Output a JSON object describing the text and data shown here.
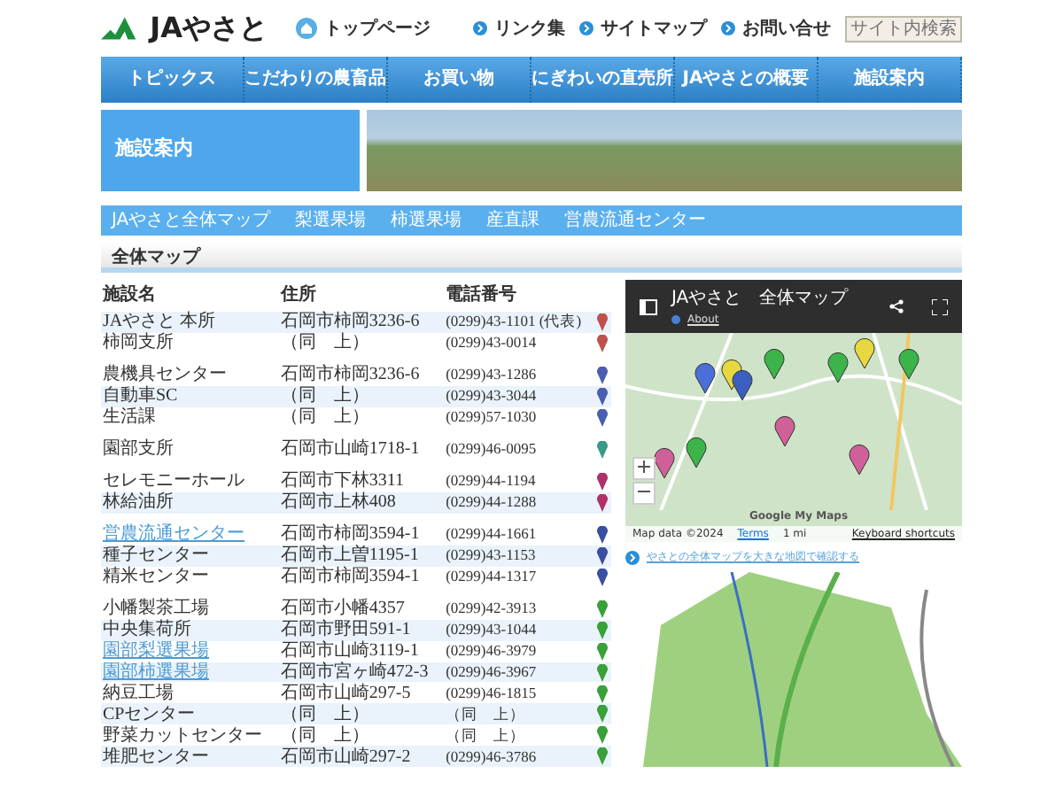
{
  "header": {
    "logo_text": "JAやさと",
    "home_link": "トップページ",
    "links": [
      "リンク集",
      "サイトマップ",
      "お問い合せ"
    ],
    "search": {
      "placeholder": "サイト内検索"
    }
  },
  "nav": [
    "トピックス",
    "こだわりの農畜品",
    "お買い物",
    "にぎわいの直売所",
    "JAやさとの概要",
    "施設案内"
  ],
  "hero": {
    "title": "施設案内"
  },
  "subnav": [
    "JAやさと全体マップ",
    "梨選果場",
    "柿選果場",
    "産直課",
    "営農流通センター"
  ],
  "section_title": "全体マップ",
  "table": {
    "columns": [
      "施設名",
      "住所",
      "電話番号"
    ],
    "groups": [
      {
        "rows": [
          {
            "name": "JAやさと 本所",
            "address": "石岡市柿岡3236-6",
            "phone": "(0299)43-1101 (代表)",
            "color": "#c0504d",
            "link": false
          },
          {
            "name": "柿岡支所",
            "address": "（同　上）",
            "phone": "(0299)43-0014",
            "color": "#c0504d",
            "link": false
          }
        ]
      },
      {
        "rows": [
          {
            "name": "農機具センター",
            "address": "石岡市柿岡3236-6",
            "phone": "(0299)43-1286",
            "color": "#4a5fb0",
            "link": false
          },
          {
            "name": "自動車SC",
            "address": "（同　上）",
            "phone": "(0299)43-3044",
            "color": "#4a5fb0",
            "link": false
          },
          {
            "name": "生活課",
            "address": "（同　上）",
            "phone": "(0299)57-1030",
            "color": "#4a5fb0",
            "link": false
          }
        ]
      },
      {
        "rows": [
          {
            "name": "園部支所",
            "address": "石岡市山崎1718-1",
            "phone": "(0299)46-0095",
            "color": "#3a9a8a",
            "link": false
          }
        ]
      },
      {
        "rows": [
          {
            "name": "セレモニーホール",
            "address": "石岡市下林3311",
            "phone": "(0299)44-1194",
            "color": "#b0306a",
            "link": false
          },
          {
            "name": "林給油所",
            "address": "石岡市上林408",
            "phone": "(0299)44-1288",
            "color": "#b0306a",
            "link": false
          }
        ]
      },
      {
        "rows": [
          {
            "name": "営農流通センター",
            "address": "石岡市柿岡3594-1",
            "phone": "(0299)44-1661",
            "color": "#3a4fa0",
            "link": true
          },
          {
            "name": "種子センター",
            "address": "石岡市上曽1195-1",
            "phone": "(0299)43-1153",
            "color": "#3a4fa0",
            "link": false
          },
          {
            "name": "精米センター",
            "address": "石岡市柿岡3594-1",
            "phone": "(0299)44-1317",
            "color": "#3a4fa0",
            "link": false
          }
        ]
      },
      {
        "rows": [
          {
            "name": "小幡製茶工場",
            "address": "石岡市小幡4357",
            "phone": "(0299)42-3913",
            "color": "#3aa03a",
            "link": false
          },
          {
            "name": "中央集荷所",
            "address": "石岡市野田591-1",
            "phone": "(0299)43-1044",
            "color": "#3aa03a",
            "link": false
          },
          {
            "name": "園部梨選果場",
            "address": "石岡市山崎3119-1",
            "phone": "(0299)46-3979",
            "color": "#3aa03a",
            "link": true
          },
          {
            "name": "園部柿選果場",
            "address": "石岡市宮ヶ崎472-3",
            "phone": "(0299)46-3967",
            "color": "#3aa03a",
            "link": true
          },
          {
            "name": "納豆工場",
            "address": "石岡市山崎297-5",
            "phone": "(0299)46-1815",
            "color": "#3aa03a",
            "link": false
          },
          {
            "name": "CPセンター",
            "address": "（同　上）",
            "phone": "（同　上）",
            "color": "#3aa03a",
            "link": false
          },
          {
            "name": "野菜カットセンター",
            "address": "（同　上）",
            "phone": "（同　上）",
            "color": "#3aa03a",
            "link": false
          },
          {
            "name": "堆肥センター",
            "address": "石岡市山崎297-2",
            "phone": "(0299)46-3786",
            "color": "#3aa03a",
            "link": false
          }
        ]
      }
    ]
  },
  "map": {
    "title": "JAやさと　全体マップ",
    "about": "About",
    "attribution": "Map data ©2024",
    "terms": "Terms",
    "scale": "1 mi",
    "shortcuts": "Keyboard shortcuts",
    "brand": "Google My Maps",
    "large_map_link": "やさとの全体マップを大きな地図で確認する"
  }
}
